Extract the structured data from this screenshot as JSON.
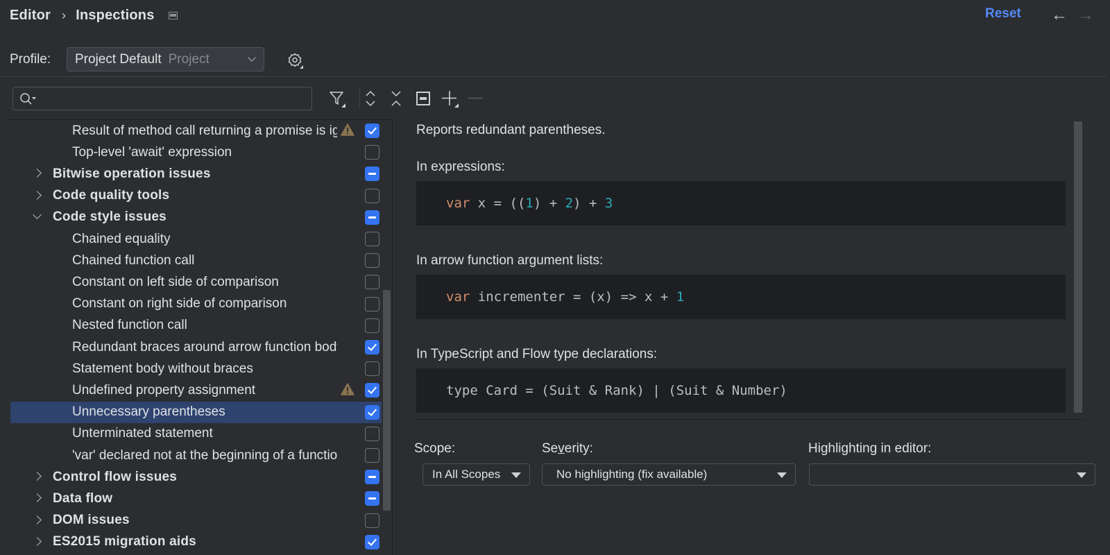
{
  "header": {
    "breadcrumb": [
      "Editor",
      "Inspections"
    ],
    "reset_label": "Reset",
    "back_icon": "arrow-left",
    "forward_icon": "arrow-right"
  },
  "profile": {
    "label": "Profile:",
    "selected": "Project Default",
    "selected_sub": "Project"
  },
  "search": {
    "value": "",
    "placeholder": ""
  },
  "toolbar": {
    "icons": [
      "filter-icon",
      "expand-all-icon",
      "collapse-all-icon",
      "reset-to-default-icon",
      "add-icon",
      "remove-icon"
    ]
  },
  "tree": {
    "rows": [
      {
        "type": "leaf",
        "label": "Result of method call returning a promise is ignored",
        "state": "on",
        "warning": true
      },
      {
        "type": "leaf",
        "label": "Top-level 'await' expression",
        "state": "off",
        "warning": false
      },
      {
        "type": "group",
        "label": "Bitwise operation issues",
        "state": "mixed",
        "expanded": false
      },
      {
        "type": "group",
        "label": "Code quality tools",
        "state": "off",
        "expanded": false
      },
      {
        "type": "group",
        "label": "Code style issues",
        "state": "mixed",
        "expanded": true
      },
      {
        "type": "leaf",
        "label": "Chained equality",
        "state": "off",
        "warning": false
      },
      {
        "type": "leaf",
        "label": "Chained function call",
        "state": "off",
        "warning": false
      },
      {
        "type": "leaf",
        "label": "Constant on left side of comparison",
        "state": "off",
        "warning": false
      },
      {
        "type": "leaf",
        "label": "Constant on right side of comparison",
        "state": "off",
        "warning": false
      },
      {
        "type": "leaf",
        "label": "Nested function call",
        "state": "off",
        "warning": false
      },
      {
        "type": "leaf",
        "label": "Redundant braces around arrow function body",
        "state": "on",
        "warning": false
      },
      {
        "type": "leaf",
        "label": "Statement body without braces",
        "state": "off",
        "warning": false
      },
      {
        "type": "leaf",
        "label": "Undefined property assignment",
        "state": "on",
        "warning": true
      },
      {
        "type": "leaf",
        "label": "Unnecessary parentheses",
        "state": "on",
        "warning": false,
        "selected": true
      },
      {
        "type": "leaf",
        "label": "Unterminated statement",
        "state": "off",
        "warning": false
      },
      {
        "type": "leaf",
        "label": "'var' declared not at the beginning of a function",
        "state": "off",
        "warning": false
      },
      {
        "type": "group",
        "label": "Control flow issues",
        "state": "mixed",
        "expanded": false
      },
      {
        "type": "group",
        "label": "Data flow",
        "state": "mixed",
        "expanded": false
      },
      {
        "type": "group",
        "label": "DOM issues",
        "state": "off",
        "expanded": false
      },
      {
        "type": "group",
        "label": "ES2015 migration aids",
        "state": "on",
        "expanded": false
      }
    ]
  },
  "description": {
    "intro": "Reports redundant parentheses.",
    "sections": [
      {
        "heading": "In expressions:",
        "code": [
          {
            "t": "var",
            "c": "kw"
          },
          {
            "t": " x = (("
          },
          {
            "t": "1",
            "c": "num"
          },
          {
            "t": ") + "
          },
          {
            "t": "2",
            "c": "num"
          },
          {
            "t": ") + "
          },
          {
            "t": "3",
            "c": "num"
          }
        ]
      },
      {
        "heading": "In arrow function argument lists:",
        "code": [
          {
            "t": "var",
            "c": "kw"
          },
          {
            "t": " incrementer = (x) => x + "
          },
          {
            "t": "1",
            "c": "num"
          }
        ]
      },
      {
        "heading": "In TypeScript and Flow type declarations:",
        "code": [
          {
            "t": "type Card = (Suit & Rank) | (Suit & Number)"
          }
        ]
      }
    ]
  },
  "options": {
    "scope_label": "Scope:",
    "scope_value": "In All Scopes",
    "severity_label_pre": "Se",
    "severity_label_mnemonic": "v",
    "severity_label_post": "erity:",
    "severity_value": "No highlighting (fix available)",
    "highlighting_label": "Highlighting in editor:",
    "highlighting_value": ""
  }
}
